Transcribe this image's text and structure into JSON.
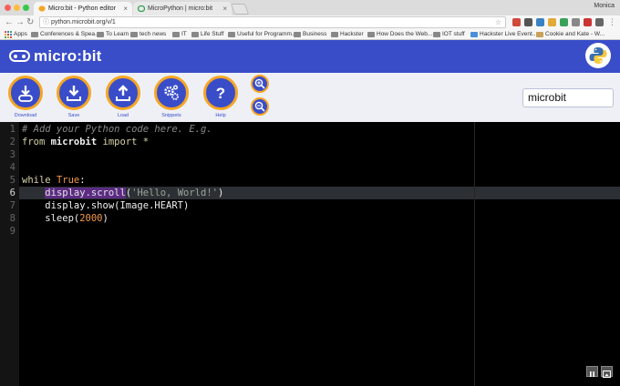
{
  "browser": {
    "tabs": [
      {
        "label": "Micro:bit - Python editor",
        "active": true
      },
      {
        "label": "MicroPython | micro:bit",
        "active": false
      }
    ],
    "user": "Monica",
    "url": "python.microbit.org/v/1",
    "bookmarks": [
      "Apps",
      "Conferences & Spea...",
      "To Learn",
      "tech news",
      "IT",
      "Life Stuff",
      "Useful for Programm...",
      "Business",
      "Hackster",
      "How Does the Web...",
      "IOT stuff",
      "Hackster Live Event...",
      "Cookie and Kate - W..."
    ]
  },
  "app": {
    "logo_text": "micro:bit",
    "toolbar": [
      {
        "label": "Download",
        "icon": "download-icon"
      },
      {
        "label": "Save",
        "icon": "save-icon"
      },
      {
        "label": "Load",
        "icon": "load-icon"
      },
      {
        "label": "Snippets",
        "icon": "snippets-icon"
      },
      {
        "label": "Help",
        "icon": "help-icon"
      }
    ],
    "zoom_in_icon": "zoom-in-icon",
    "zoom_out_icon": "zoom-out-icon",
    "script_name": "microbit",
    "accent": "#3a4dc9",
    "highlight": "#f5a623"
  },
  "editor": {
    "line_numbers": [
      "1",
      "2",
      "3",
      "4",
      "5",
      "6",
      "7",
      "8",
      "9"
    ],
    "current_line": "6",
    "lines": {
      "l1": "# Add your Python code here. E.g.",
      "l2a": "from ",
      "l2b": "microbit",
      "l2c": " import *",
      "l5a": "while ",
      "l5b": "True",
      "l5c": ":",
      "l6a": "    ",
      "l6b": "display.scroll",
      "l6c": "(",
      "l6d": "'Hello, World!'",
      "l6e": ")",
      "l7": "    display.show(Image.HEART)",
      "l8a": "    sleep(",
      "l8b": "2000",
      "l8c": ")"
    }
  }
}
